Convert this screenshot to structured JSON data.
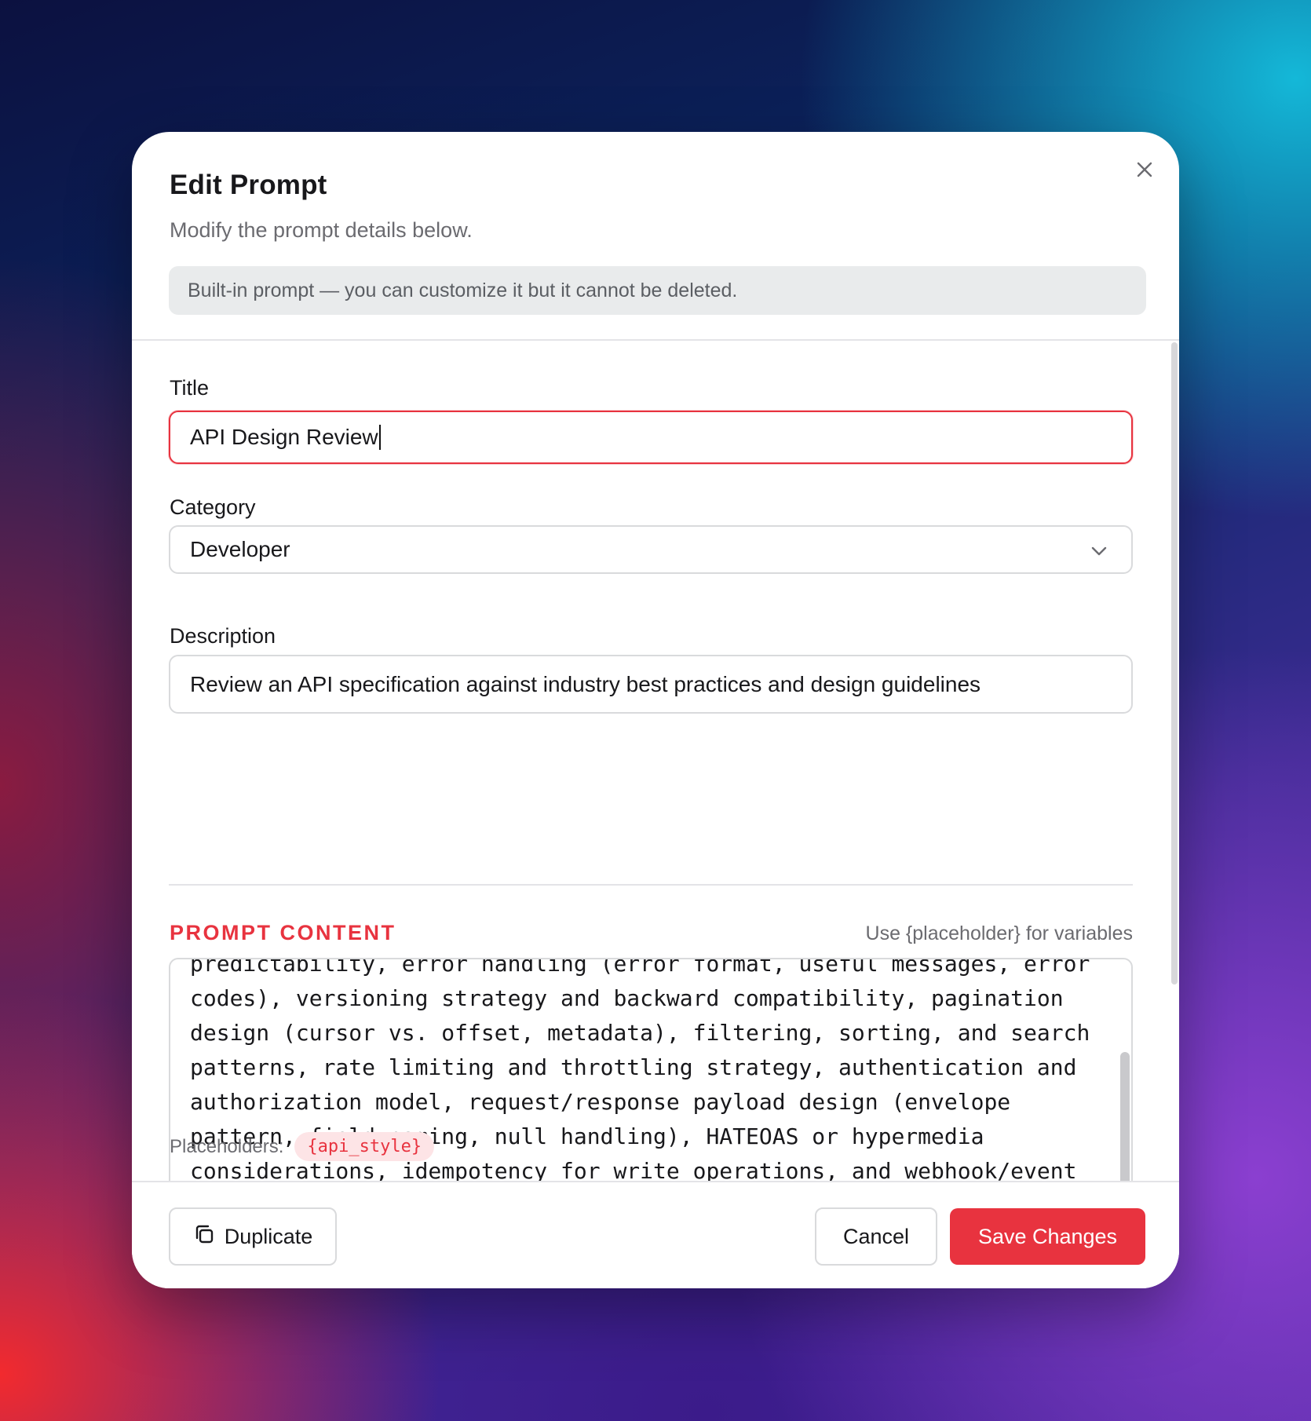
{
  "dialog": {
    "title": "Edit Prompt",
    "subtitle": "Modify the prompt details below.",
    "info_banner": "Built-in prompt — you can customize it but it cannot be deleted."
  },
  "form": {
    "title_label": "Title",
    "title_value": "API Design Review",
    "category_label": "Category",
    "category_value": "Developer",
    "description_label": "Description",
    "description_value": "Review an API specification against industry best practices and design guidelines",
    "prompt_content_label": "PROMPT CONTENT",
    "prompt_content_hint": "Use {placeholder} for variables",
    "prompt_content_value": "predictability, error handling (error format, useful messages, error\ncodes), versioning strategy and backward compatibility, pagination\ndesign (cursor vs. offset, metadata), filtering, sorting, and search\npatterns, rate limiting and throttling strategy, authentication and\nauthorization model, request/response payload design (envelope\npattern, field naming, null handling), HATEOAS or hypermedia\nconsiderations, idempotency for write operations, and webhook/event\ndesign if applicable. Search the web for current best practices from\n{api_style} API design guidelines and compare.",
    "placeholders_label": "Placeholders:",
    "placeholders": [
      "{api_style}"
    ]
  },
  "footer": {
    "duplicate_label": "Duplicate",
    "cancel_label": "Cancel",
    "save_label": "Save Changes"
  },
  "colors": {
    "accent": "#e8333f",
    "info_bg": "#e9ebec"
  },
  "icons": {
    "close": "close-icon",
    "chevron": "chevron-down-icon",
    "duplicate": "copy-icon"
  }
}
